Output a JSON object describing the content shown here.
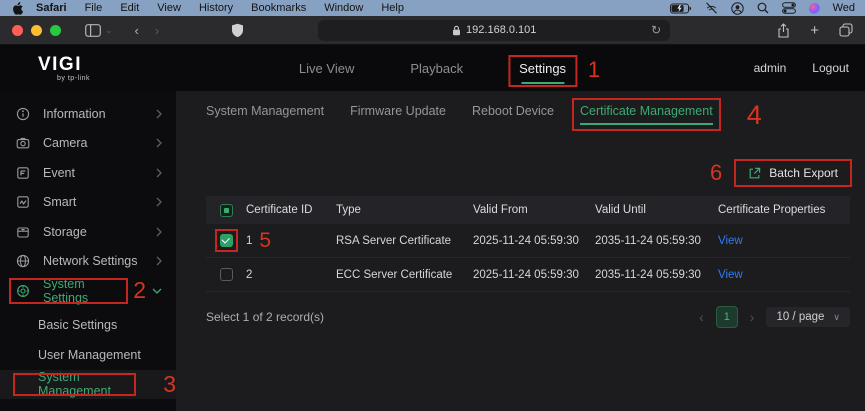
{
  "menubar": {
    "items": [
      "Safari",
      "File",
      "Edit",
      "View",
      "History",
      "Bookmarks",
      "Window",
      "Help"
    ],
    "clock": "Wed"
  },
  "browser": {
    "url": "192.168.0.101",
    "reload_glyph": "↻",
    "new_tab_glyph": "+"
  },
  "header": {
    "logo": "VIGI",
    "logo_sub": "by tp-link",
    "nav": [
      {
        "label": "Live View"
      },
      {
        "label": "Playback"
      },
      {
        "label": "Settings"
      }
    ],
    "user": "admin",
    "logout": "Logout"
  },
  "sidebar": {
    "items": [
      {
        "label": "Information"
      },
      {
        "label": "Camera"
      },
      {
        "label": "Event"
      },
      {
        "label": "Smart"
      },
      {
        "label": "Storage"
      },
      {
        "label": "Network Settings"
      },
      {
        "label": "System Settings"
      }
    ],
    "subitems": [
      {
        "label": "Basic Settings"
      },
      {
        "label": "User Management"
      },
      {
        "label": "System Management"
      }
    ]
  },
  "tabs": [
    {
      "label": "System Management"
    },
    {
      "label": "Firmware Update"
    },
    {
      "label": "Reboot Device"
    },
    {
      "label": "Certificate Management"
    }
  ],
  "actions": {
    "batch_export_label": "Batch Export"
  },
  "table": {
    "header_checked": "indeterminate",
    "headers": [
      "Certificate ID",
      "Type",
      "Valid From",
      "Valid Until",
      "Certificate Properties"
    ],
    "rows": [
      {
        "checked": true,
        "id": "1",
        "type": "RSA Server Certificate",
        "valid_from": "2025-11-24 05:59:30",
        "valid_until": "2035-11-24 05:59:30",
        "action": "View"
      },
      {
        "checked": false,
        "id": "2",
        "type": "ECC Server Certificate",
        "valid_from": "2025-11-24 05:59:30",
        "valid_until": "2035-11-24 05:59:30",
        "action": "View"
      }
    ]
  },
  "footer": {
    "summary": "Select 1 of 2 record(s)",
    "prev_glyph": "‹",
    "page": "1",
    "next_glyph": "›",
    "page_size": "10 / page"
  },
  "annotations": {
    "n1": "1",
    "n2": "2",
    "n3": "3",
    "n4": "4",
    "n5": "5",
    "n6": "6"
  },
  "colors": {
    "accent_green": "#3cab73",
    "annotation_red": "#c5261f",
    "link_blue": "#2e7bff"
  }
}
